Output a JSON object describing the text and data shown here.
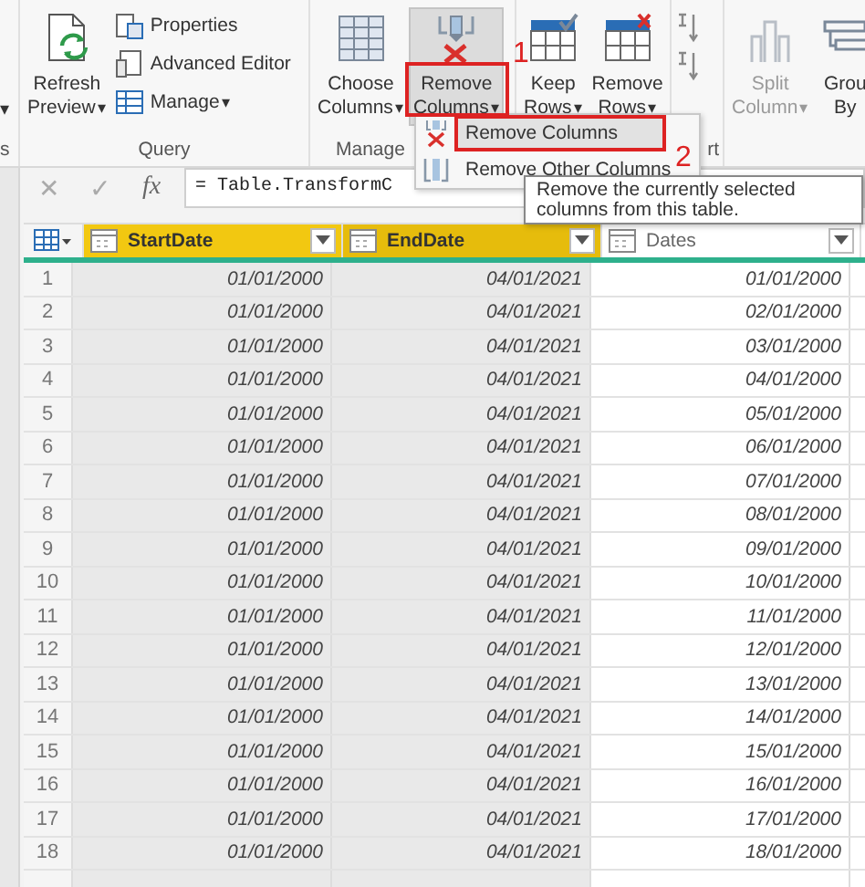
{
  "ribbon": {
    "groups": [
      {
        "label": "s",
        "items": [
          {
            "kind": "caret",
            "caret": "▾"
          }
        ]
      },
      {
        "label": "Query",
        "items": [
          {
            "kind": "large",
            "lines": [
              "Refresh",
              "Preview"
            ],
            "caret": "▾",
            "pressed": false,
            "disabled": false
          },
          {
            "kind": "stack",
            "buttons": [
              {
                "label": "Properties"
              },
              {
                "label": "Advanced Editor"
              },
              {
                "label": "Manage",
                "caret": "▾"
              }
            ]
          }
        ]
      },
      {
        "label": "Manage",
        "items": [
          {
            "kind": "large",
            "lines": [
              "Choose",
              "Columns"
            ],
            "caret": "▾",
            "pressed": false,
            "disabled": false
          },
          {
            "kind": "large",
            "lines": [
              "Remove",
              "Columns"
            ],
            "caret": "▾",
            "pressed": true,
            "disabled": false
          }
        ]
      },
      {
        "items": [
          {
            "kind": "large",
            "lines": [
              "Keep",
              "Rows"
            ],
            "caret": "▾",
            "pressed": false,
            "disabled": false
          },
          {
            "kind": "large",
            "lines": [
              "Remove",
              "Rows"
            ],
            "caret": "▾",
            "pressed": false,
            "disabled": false
          }
        ]
      },
      {
        "label": "rt",
        "items": [
          {
            "kind": "sort"
          }
        ]
      },
      {
        "items": [
          {
            "kind": "large",
            "lines": [
              "Split",
              "Column"
            ],
            "caret": "▾",
            "pressed": false,
            "disabled": true
          },
          {
            "kind": "large",
            "lines": [
              "Grou",
              "By"
            ],
            "pressed": false,
            "disabled": false
          }
        ]
      }
    ]
  },
  "menu": {
    "items": [
      {
        "label": "Remove Columns",
        "selected": true
      },
      {
        "label": "Remove Other Columns",
        "selected": false
      }
    ]
  },
  "tooltip": "Remove the currently selected columns from this table.",
  "callouts": [
    "1",
    "2"
  ],
  "formula_bar": {
    "cancel": "✕",
    "confirm": "✓",
    "fx": "fx",
    "formula": "= Table.TransformC"
  },
  "table": {
    "columns": [
      {
        "name": "StartDate",
        "selected": true
      },
      {
        "name": "EndDate",
        "selected": true
      },
      {
        "name": "Dates",
        "selected": false
      }
    ],
    "rows": [
      {
        "number": "1",
        "cells": [
          "01/01/2000",
          "04/01/2021",
          "01/01/2000"
        ]
      },
      {
        "number": "2",
        "cells": [
          "01/01/2000",
          "04/01/2021",
          "02/01/2000"
        ]
      },
      {
        "number": "3",
        "cells": [
          "01/01/2000",
          "04/01/2021",
          "03/01/2000"
        ]
      },
      {
        "number": "4",
        "cells": [
          "01/01/2000",
          "04/01/2021",
          "04/01/2000"
        ]
      },
      {
        "number": "5",
        "cells": [
          "01/01/2000",
          "04/01/2021",
          "05/01/2000"
        ]
      },
      {
        "number": "6",
        "cells": [
          "01/01/2000",
          "04/01/2021",
          "06/01/2000"
        ]
      },
      {
        "number": "7",
        "cells": [
          "01/01/2000",
          "04/01/2021",
          "07/01/2000"
        ]
      },
      {
        "number": "8",
        "cells": [
          "01/01/2000",
          "04/01/2021",
          "08/01/2000"
        ]
      },
      {
        "number": "9",
        "cells": [
          "01/01/2000",
          "04/01/2021",
          "09/01/2000"
        ]
      },
      {
        "number": "10",
        "cells": [
          "01/01/2000",
          "04/01/2021",
          "10/01/2000"
        ]
      },
      {
        "number": "11",
        "cells": [
          "01/01/2000",
          "04/01/2021",
          "11/01/2000"
        ]
      },
      {
        "number": "12",
        "cells": [
          "01/01/2000",
          "04/01/2021",
          "12/01/2000"
        ]
      },
      {
        "number": "13",
        "cells": [
          "01/01/2000",
          "04/01/2021",
          "13/01/2000"
        ]
      },
      {
        "number": "14",
        "cells": [
          "01/01/2000",
          "04/01/2021",
          "14/01/2000"
        ]
      },
      {
        "number": "15",
        "cells": [
          "01/01/2000",
          "04/01/2021",
          "15/01/2000"
        ]
      },
      {
        "number": "16",
        "cells": [
          "01/01/2000",
          "04/01/2021",
          "16/01/2000"
        ]
      },
      {
        "number": "17",
        "cells": [
          "01/01/2000",
          "04/01/2021",
          "17/01/2000"
        ]
      },
      {
        "number": "18",
        "cells": [
          "01/01/2000",
          "04/01/2021",
          "18/01/2000"
        ]
      }
    ]
  }
}
